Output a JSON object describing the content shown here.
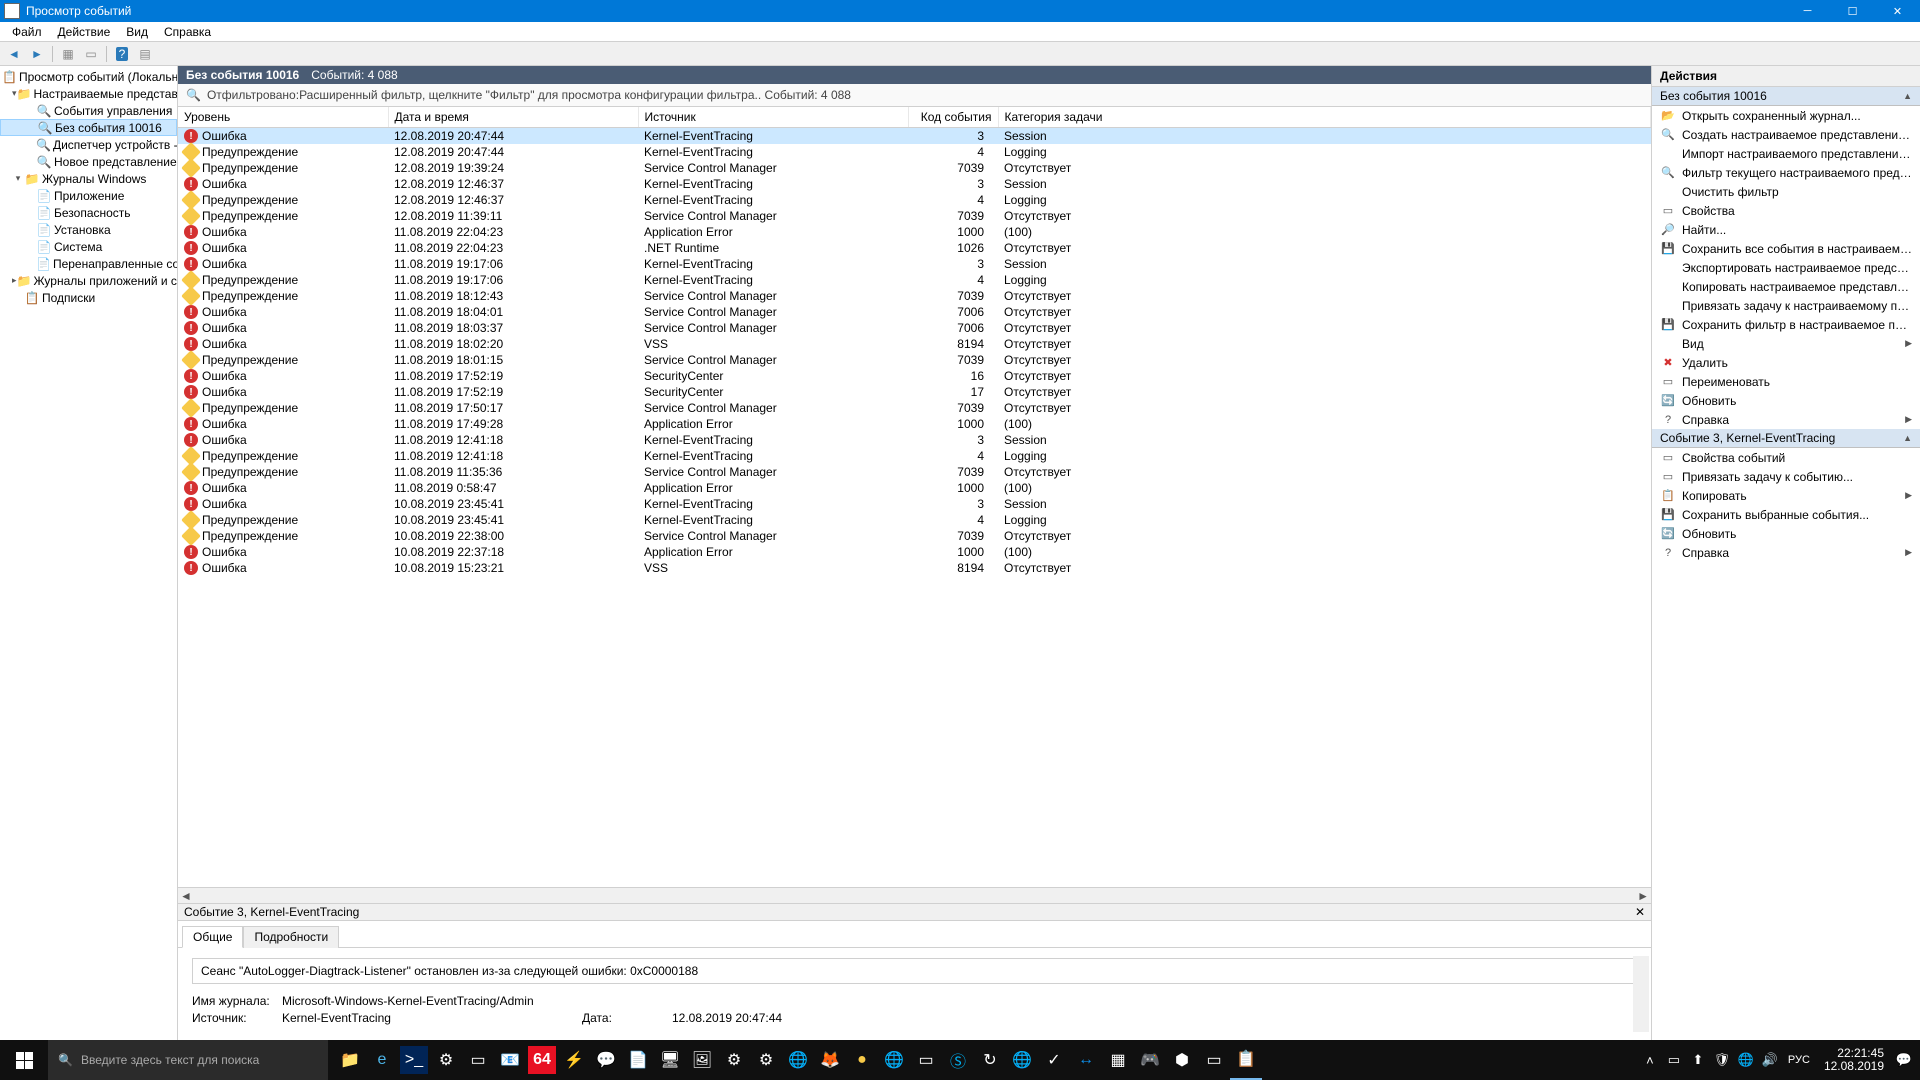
{
  "window": {
    "title": "Просмотр событий"
  },
  "menu": {
    "file": "Файл",
    "action": "Действие",
    "view": "Вид",
    "help": "Справка"
  },
  "tree": {
    "root": "Просмотр событий (Локальный)",
    "custom_views": "Настраиваемые представления",
    "admin_events": "События управления",
    "no_event_10016": "Без события 10016",
    "device_mgr": "Диспетчер устройств - V",
    "new_view": "Новое представление",
    "win_logs": "Журналы Windows",
    "application": "Приложение",
    "security": "Безопасность",
    "setup": "Установка",
    "system": "Система",
    "forwarded": "Перенаправленные события",
    "app_svc_logs": "Журналы приложений и служб",
    "subscriptions": "Подписки"
  },
  "center": {
    "header_title": "Без события 10016",
    "header_count": "Событий: 4 088",
    "filter_text": "Отфильтровано:Расширенный фильтр, щелкните \"Фильтр\" для просмотра конфигурации фильтра.. Событий: 4 088"
  },
  "columns": {
    "level": "Уровень",
    "datetime": "Дата и время",
    "source": "Источник",
    "eventid": "Код события",
    "category": "Категория задачи"
  },
  "levels": {
    "error": "Ошибка",
    "warning": "Предупреждение"
  },
  "events": [
    {
      "l": "error",
      "dt": "12.08.2019 20:47:44",
      "src": "Kernel-EventTracing",
      "id": 3,
      "cat": "Session",
      "sel": true
    },
    {
      "l": "warning",
      "dt": "12.08.2019 20:47:44",
      "src": "Kernel-EventTracing",
      "id": 4,
      "cat": "Logging"
    },
    {
      "l": "warning",
      "dt": "12.08.2019 19:39:24",
      "src": "Service Control Manager",
      "id": 7039,
      "cat": "Отсутствует"
    },
    {
      "l": "error",
      "dt": "12.08.2019 12:46:37",
      "src": "Kernel-EventTracing",
      "id": 3,
      "cat": "Session"
    },
    {
      "l": "warning",
      "dt": "12.08.2019 12:46:37",
      "src": "Kernel-EventTracing",
      "id": 4,
      "cat": "Logging"
    },
    {
      "l": "warning",
      "dt": "12.08.2019 11:39:11",
      "src": "Service Control Manager",
      "id": 7039,
      "cat": "Отсутствует"
    },
    {
      "l": "error",
      "dt": "11.08.2019 22:04:23",
      "src": "Application Error",
      "id": 1000,
      "cat": "(100)"
    },
    {
      "l": "error",
      "dt": "11.08.2019 22:04:23",
      "src": ".NET Runtime",
      "id": 1026,
      "cat": "Отсутствует"
    },
    {
      "l": "error",
      "dt": "11.08.2019 19:17:06",
      "src": "Kernel-EventTracing",
      "id": 3,
      "cat": "Session"
    },
    {
      "l": "warning",
      "dt": "11.08.2019 19:17:06",
      "src": "Kernel-EventTracing",
      "id": 4,
      "cat": "Logging"
    },
    {
      "l": "warning",
      "dt": "11.08.2019 18:12:43",
      "src": "Service Control Manager",
      "id": 7039,
      "cat": "Отсутствует"
    },
    {
      "l": "error",
      "dt": "11.08.2019 18:04:01",
      "src": "Service Control Manager",
      "id": 7006,
      "cat": "Отсутствует"
    },
    {
      "l": "error",
      "dt": "11.08.2019 18:03:37",
      "src": "Service Control Manager",
      "id": 7006,
      "cat": "Отсутствует"
    },
    {
      "l": "error",
      "dt": "11.08.2019 18:02:20",
      "src": "VSS",
      "id": 8194,
      "cat": "Отсутствует"
    },
    {
      "l": "warning",
      "dt": "11.08.2019 18:01:15",
      "src": "Service Control Manager",
      "id": 7039,
      "cat": "Отсутствует"
    },
    {
      "l": "error",
      "dt": "11.08.2019 17:52:19",
      "src": "SecurityCenter",
      "id": 16,
      "cat": "Отсутствует"
    },
    {
      "l": "error",
      "dt": "11.08.2019 17:52:19",
      "src": "SecurityCenter",
      "id": 17,
      "cat": "Отсутствует"
    },
    {
      "l": "warning",
      "dt": "11.08.2019 17:50:17",
      "src": "Service Control Manager",
      "id": 7039,
      "cat": "Отсутствует"
    },
    {
      "l": "error",
      "dt": "11.08.2019 17:49:28",
      "src": "Application Error",
      "id": 1000,
      "cat": "(100)"
    },
    {
      "l": "error",
      "dt": "11.08.2019 12:41:18",
      "src": "Kernel-EventTracing",
      "id": 3,
      "cat": "Session"
    },
    {
      "l": "warning",
      "dt": "11.08.2019 12:41:18",
      "src": "Kernel-EventTracing",
      "id": 4,
      "cat": "Logging"
    },
    {
      "l": "warning",
      "dt": "11.08.2019 11:35:36",
      "src": "Service Control Manager",
      "id": 7039,
      "cat": "Отсутствует"
    },
    {
      "l": "error",
      "dt": "11.08.2019 0:58:47",
      "src": "Application Error",
      "id": 1000,
      "cat": "(100)"
    },
    {
      "l": "error",
      "dt": "10.08.2019 23:45:41",
      "src": "Kernel-EventTracing",
      "id": 3,
      "cat": "Session"
    },
    {
      "l": "warning",
      "dt": "10.08.2019 23:45:41",
      "src": "Kernel-EventTracing",
      "id": 4,
      "cat": "Logging"
    },
    {
      "l": "warning",
      "dt": "10.08.2019 22:38:00",
      "src": "Service Control Manager",
      "id": 7039,
      "cat": "Отсутствует"
    },
    {
      "l": "error",
      "dt": "10.08.2019 22:37:18",
      "src": "Application Error",
      "id": 1000,
      "cat": "(100)"
    },
    {
      "l": "error",
      "dt": "10.08.2019 15:23:21",
      "src": "VSS",
      "id": 8194,
      "cat": "Отсутствует"
    }
  ],
  "detail": {
    "header": "Событие 3, Kernel-EventTracing",
    "tab_general": "Общие",
    "tab_details": "Подробности",
    "message": "Сеанс \"AutoLogger-Diagtrack-Listener\" остановлен из-за следующей ошибки: 0xC0000188",
    "log_name_label": "Имя журнала:",
    "log_name": "Microsoft-Windows-Kernel-EventTracing/Admin",
    "source_label": "Источник:",
    "source": "Kernel-EventTracing",
    "date_label": "Дата:",
    "date": "12.08.2019 20:47:44"
  },
  "actions": {
    "title": "Действия",
    "group1": "Без события 10016",
    "items1": [
      {
        "ico": "📂",
        "t": "Открыть сохраненный журнал..."
      },
      {
        "ico": "🔍",
        "t": "Создать настраиваемое представление..."
      },
      {
        "ico": "",
        "t": "Импорт настраиваемого представления..."
      },
      {
        "ico": "🔍",
        "t": "Фильтр текущего настраиваемого представл..."
      },
      {
        "ico": "",
        "t": "Очистить фильтр"
      },
      {
        "ico": "▭",
        "t": "Свойства"
      },
      {
        "ico": "🔎",
        "t": "Найти..."
      },
      {
        "ico": "💾",
        "t": "Сохранить все события в настраиваемом пре..."
      },
      {
        "ico": "",
        "t": "Экспортировать настраиваемое представлен..."
      },
      {
        "ico": "",
        "t": "Копировать настраиваемое представление..."
      },
      {
        "ico": "",
        "t": "Привязать задачу к настраиваемому предста..."
      },
      {
        "ico": "💾",
        "t": "Сохранить фильтр в настраиваемое представ..."
      },
      {
        "ico": "",
        "t": "Вид",
        "arrow": true
      },
      {
        "ico": "✖",
        "t": "Удалить",
        "iconColor": "#d43131"
      },
      {
        "ico": "▭",
        "t": "Переименовать"
      },
      {
        "ico": "🔄",
        "t": "Обновить"
      },
      {
        "ico": "?",
        "t": "Справка",
        "arrow": true
      }
    ],
    "group2": "Событие 3, Kernel-EventTracing",
    "items2": [
      {
        "ico": "▭",
        "t": "Свойства событий"
      },
      {
        "ico": "▭",
        "t": "Привязать задачу к событию..."
      },
      {
        "ico": "📋",
        "t": "Копировать",
        "arrow": true
      },
      {
        "ico": "💾",
        "t": "Сохранить выбранные события..."
      },
      {
        "ico": "🔄",
        "t": "Обновить"
      },
      {
        "ico": "?",
        "t": "Справка",
        "arrow": true
      }
    ]
  },
  "taskbar": {
    "search_placeholder": "Введите здесь текст для поиска",
    "clock_time": "22:21:45",
    "clock_date": "12.08.2019",
    "lang": "РУС"
  }
}
